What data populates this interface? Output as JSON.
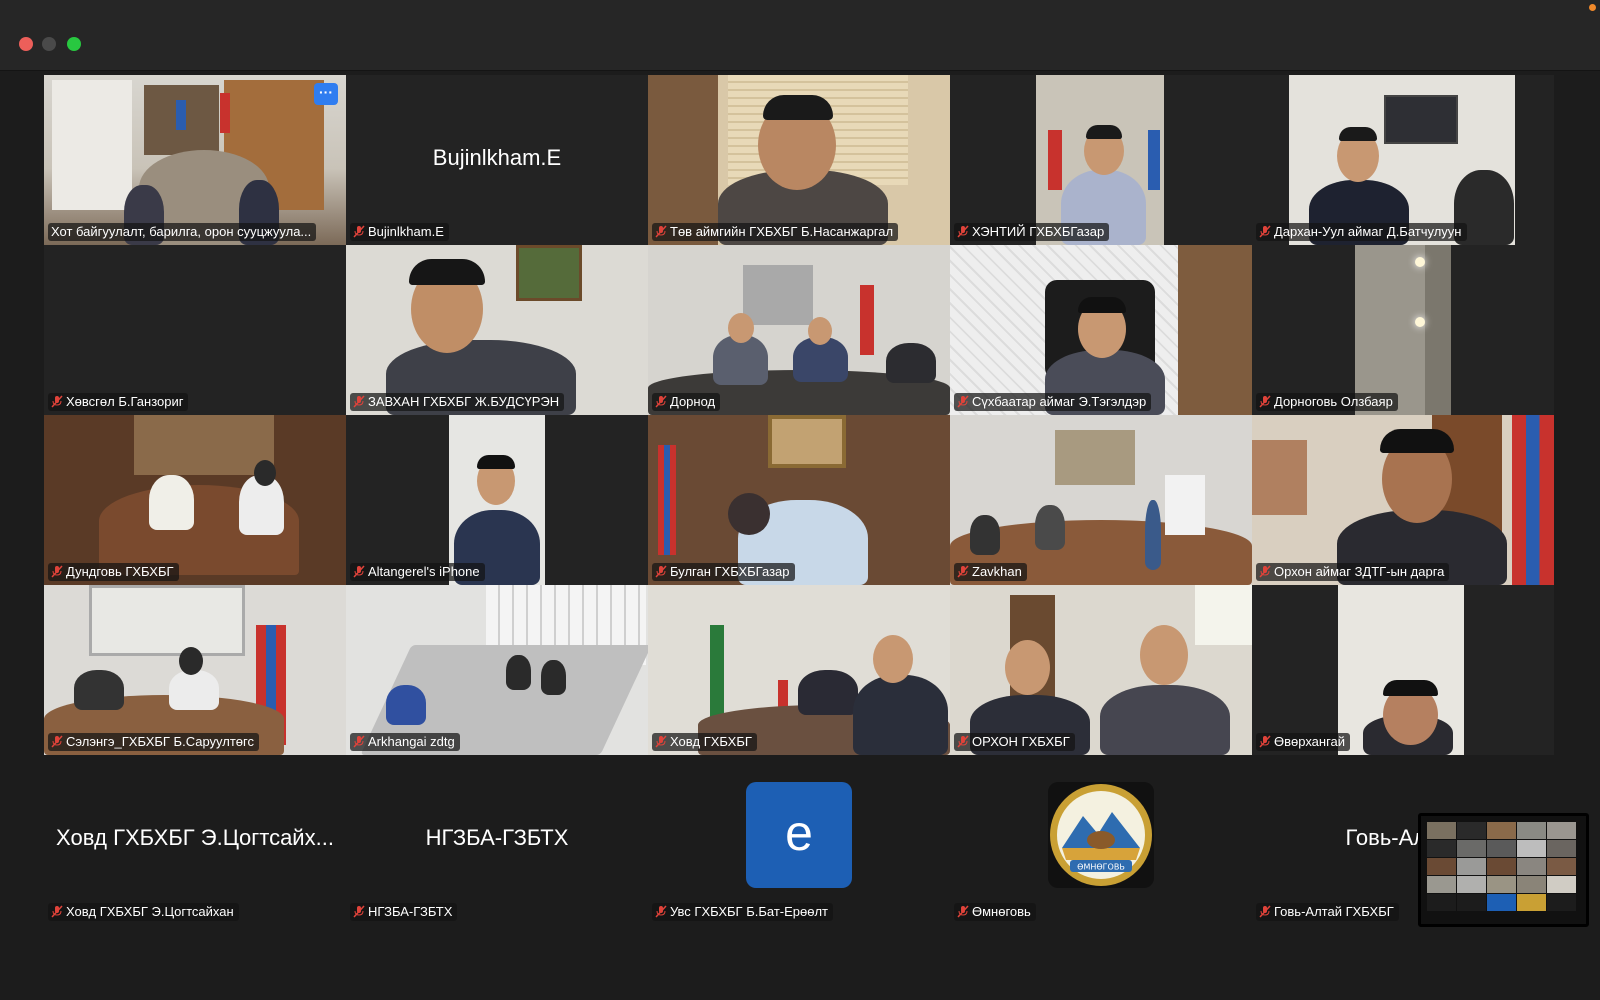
{
  "window": {
    "traffic_lights": [
      "close",
      "minimize",
      "maximize"
    ]
  },
  "tiles": [
    {
      "name": "Хот байгуулалт, барилга, орон сууцжуула...",
      "active": true,
      "muted": false,
      "video": true,
      "more": "···"
    },
    {
      "name": "Bujinlkham.E",
      "center_name": "Bujinlkham.E",
      "muted": true,
      "video": false
    },
    {
      "name": "Төв аймгийн ГХБХБГ Б.Насанжаргал",
      "muted": true,
      "video": true
    },
    {
      "name": "ХЭНТИЙ ГХБХБГазар",
      "muted": true,
      "video": true
    },
    {
      "name": "Дархан-Уул аймаг Д.Батчулуун",
      "muted": true,
      "video": true
    },
    {
      "name": "Хөвсгөл Б.Ганзориг",
      "muted": true,
      "video": false
    },
    {
      "name": "ЗАВХАН ГХБХБГ Ж.БУДСҮРЭН",
      "muted": true,
      "video": true
    },
    {
      "name": "Дорнод",
      "muted": true,
      "video": true
    },
    {
      "name": "Сүхбаатар аймаг Э.Тэгэлдэр",
      "muted": true,
      "video": true
    },
    {
      "name": "Дорноговь Олзбаяр",
      "muted": true,
      "video": true
    },
    {
      "name": "Дундговь ГХБХБГ",
      "muted": true,
      "video": true
    },
    {
      "name": "Altangerel's iPhone",
      "muted": true,
      "video": true
    },
    {
      "name": "Булган ГХБХБГазар",
      "muted": true,
      "video": true
    },
    {
      "name": "Zavkhan",
      "muted": true,
      "video": true
    },
    {
      "name": "Орхон аймаг ЗДТГ-ын дарга",
      "muted": true,
      "video": true
    },
    {
      "name": "Сэлэнгэ_ГХБХБГ Б.Саруултөгс",
      "muted": true,
      "video": true
    },
    {
      "name": "Arkhangai zdtg",
      "muted": true,
      "video": true
    },
    {
      "name": "Ховд ГХБХБГ",
      "muted": true,
      "video": true
    },
    {
      "name": "ОРХОН ГХБХБГ",
      "muted": true,
      "video": true
    },
    {
      "name": "Өвөрхангай",
      "muted": true,
      "video": true
    },
    {
      "name": "Ховд ГХБХБГ Э.Цогтсайхан",
      "center_name": "Ховд ГХБХБГ Э.Цогтсайх...",
      "muted": true,
      "video": false
    },
    {
      "name": "НГЗБА-ГЗБТХ",
      "center_name": "НГЗБА-ГЗБТХ",
      "muted": true,
      "video": false
    },
    {
      "name": "Увс ГХБХБГ Б.Бат-Ерөөлт",
      "avatar_letter": "e",
      "muted": true,
      "video": false
    },
    {
      "name": "Өмнөговь",
      "avatar_logo_text": "ӨМНӨГОВЬ",
      "muted": true,
      "video": false
    },
    {
      "name": "Говь-Алтай ГХБХБГ",
      "center_name": "Говь-Алтай",
      "muted": true,
      "video": false
    }
  ],
  "colors": {
    "active_border": "#34c759",
    "muted_icon": "#e0433a",
    "avatar_blue": "#1d5fb4"
  }
}
